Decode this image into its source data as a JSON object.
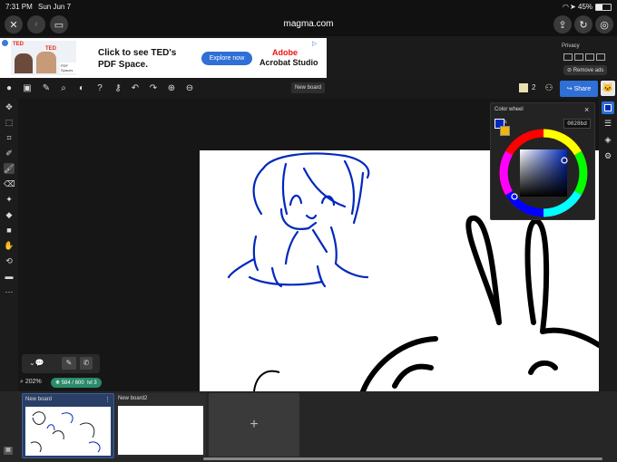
{
  "status": {
    "time": "7:31 PM",
    "date": "Sun Jun 7",
    "battery": "45%"
  },
  "browser": {
    "url": "magma.com"
  },
  "ad": {
    "brand": "TED",
    "headline_line1": "Click to see TED's",
    "headline_line2": "PDF Space.",
    "cta": "Explore now",
    "advertiser_line1": "Adobe",
    "advertiser_line2": "Acrobat Studio",
    "thumb_text": "PDF Spaces"
  },
  "ads_panel": {
    "privacy": "Privacy",
    "remove": "Remove ads"
  },
  "toolbar": {
    "new_board_label": "New board",
    "user_count": "2",
    "share_label": "Share"
  },
  "color_panel": {
    "title": "Color wheel",
    "hex": "0028bd",
    "close": "×"
  },
  "colors": {
    "primary": "#0028bd",
    "secondary": "#f2b705",
    "accent": "#2f6fd6",
    "badge": "#2a8a6a"
  },
  "status_bottom": {
    "zoom": "202%",
    "counter": "584 / 600",
    "level": "lvl 3"
  },
  "boards": [
    {
      "name": "New board"
    },
    {
      "name": "New board2"
    }
  ],
  "add_board": "+"
}
